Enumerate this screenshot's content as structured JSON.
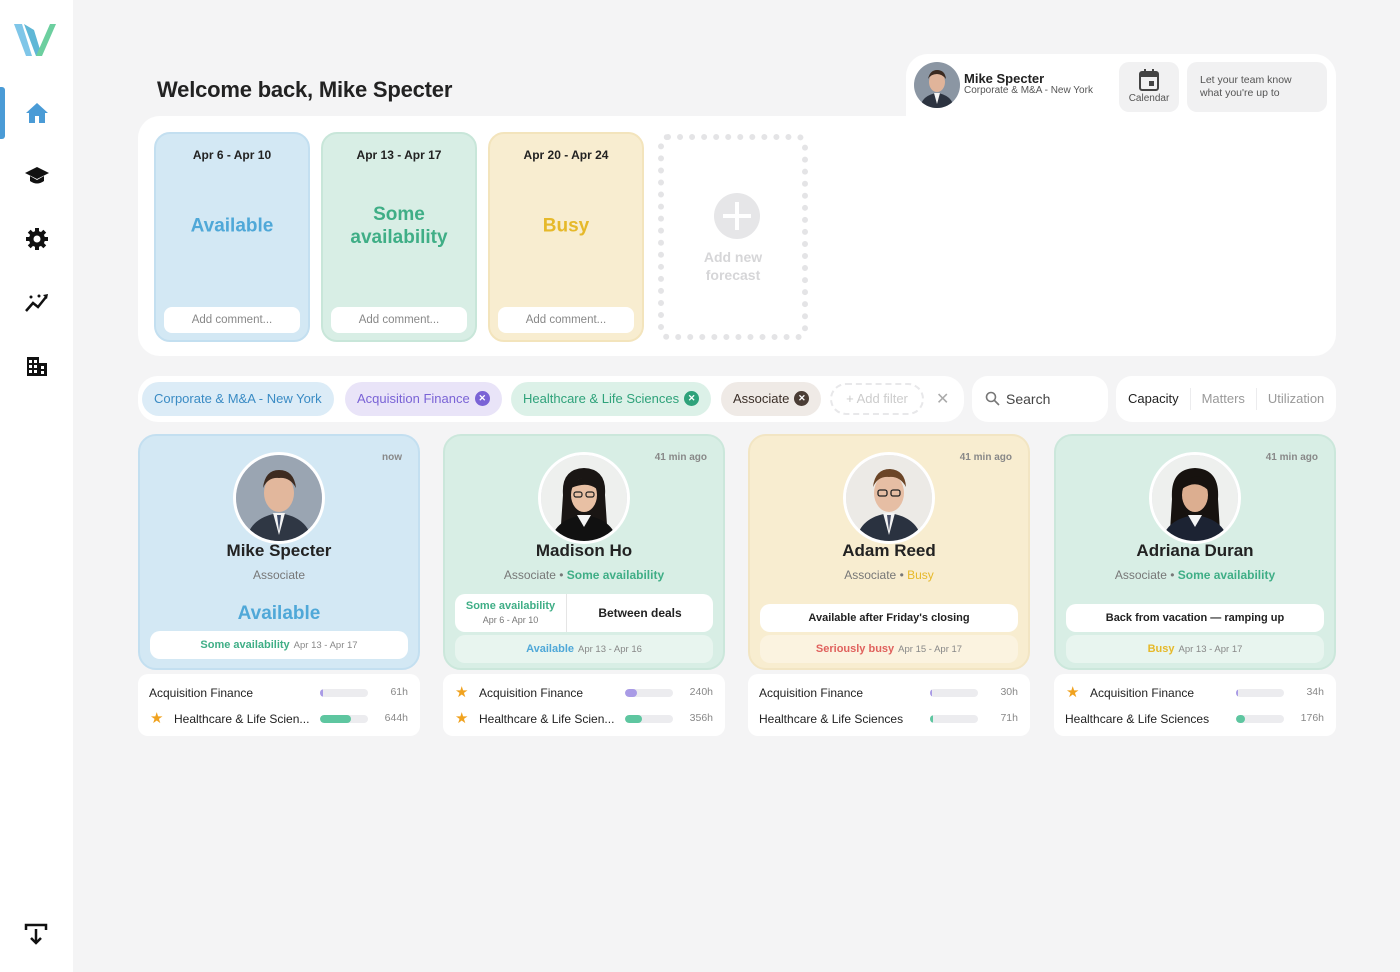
{
  "header": {
    "welcome": "Welcome back, Mike Specter"
  },
  "sidebar": {
    "items": [
      "home-icon",
      "graduation-cap-icon",
      "gear-icon",
      "analytics-icon",
      "building-icon"
    ],
    "export": "export-icon"
  },
  "profile": {
    "name": "Mike Specter",
    "subtitle": "Corporate & M&A - New York",
    "calendar_label": "Calendar",
    "status_prompt_1": "Let your team know",
    "status_prompt_2": "what you're up to"
  },
  "forecasts": [
    {
      "dates": "Apr 6 - Apr 10",
      "status": "Available",
      "comment": "Add comment...",
      "color": "#4fa8d8",
      "bg": "#d3e8f4"
    },
    {
      "dates": "Apr 13 - Apr 17",
      "status": "Some availability",
      "comment": "Add comment...",
      "color": "#3fae86",
      "bg": "#d8eee5"
    },
    {
      "dates": "Apr 20 - Apr 24",
      "status": "Busy",
      "comment": "Add comment...",
      "color": "#e6b92a",
      "bg": "#f8edd0"
    }
  ],
  "add_forecast": {
    "line1": "Add new",
    "line2": "forecast"
  },
  "filters": {
    "chips": [
      {
        "label": "Corporate & M&A - New York",
        "removable": false
      },
      {
        "label": "Acquisition Finance",
        "removable": true
      },
      {
        "label": "Healthcare & Life Sciences",
        "removable": true
      },
      {
        "label": "Associate",
        "removable": true
      }
    ],
    "add_filter": "+ Add filter",
    "clear": "✕"
  },
  "search": {
    "placeholder": "Search"
  },
  "view_tabs": [
    "Capacity",
    "Matters",
    "Utilization"
  ],
  "people": [
    {
      "name": "Mike Specter",
      "role": "Associate",
      "time": "now",
      "status": "Available",
      "pill_status": "Some availability",
      "pill_dates": "Apr 13 - Apr 17",
      "matters": [
        {
          "name": "Acquisition Finance",
          "star": false,
          "hours": "61h",
          "fill": 0.06,
          "color": "#a99be6"
        },
        {
          "name": "Healthcare & Life Scien...",
          "star": true,
          "hours": "644h",
          "fill": 0.65,
          "color": "#5ec6a0"
        }
      ]
    },
    {
      "name": "Madison Ho",
      "role": "Associate",
      "role_status": "Some availability",
      "time": "41 min ago",
      "split_status": "Some availability",
      "split_dates": "Apr 6 - Apr 10",
      "split_note": "Between deals",
      "pill_status": "Available",
      "pill_dates": "Apr 13 - Apr 16",
      "matters": [
        {
          "name": "Acquisition Finance",
          "star": true,
          "hours": "240h",
          "fill": 0.25,
          "color": "#a99be6"
        },
        {
          "name": "Healthcare & Life Scien...",
          "star": true,
          "hours": "356h",
          "fill": 0.36,
          "color": "#5ec6a0"
        }
      ]
    },
    {
      "name": "Adam Reed",
      "role": "Associate",
      "role_status": "Busy",
      "time": "41 min ago",
      "note": "Available after Friday's closing",
      "pill_status": "Seriously busy",
      "pill_dates": "Apr 15 - Apr 17",
      "matters": [
        {
          "name": "Acquisition Finance",
          "star": false,
          "hours": "30h",
          "fill": 0.04,
          "color": "#a99be6"
        },
        {
          "name": "Healthcare & Life Sciences",
          "star": false,
          "hours": "71h",
          "fill": 0.07,
          "color": "#5ec6a0"
        }
      ]
    },
    {
      "name": "Adriana Duran",
      "role": "Associate",
      "role_status": "Some availability",
      "time": "41 min ago",
      "note": "Back from vacation — ramping up",
      "pill_status": "Busy",
      "pill_dates": "Apr 13 - Apr 17",
      "matters": [
        {
          "name": "Acquisition Finance",
          "star": true,
          "hours": "34h",
          "fill": 0.04,
          "color": "#a99be6"
        },
        {
          "name": "Healthcare & Life Sciences",
          "star": false,
          "hours": "176h",
          "fill": 0.18,
          "color": "#5ec6a0"
        }
      ]
    }
  ]
}
